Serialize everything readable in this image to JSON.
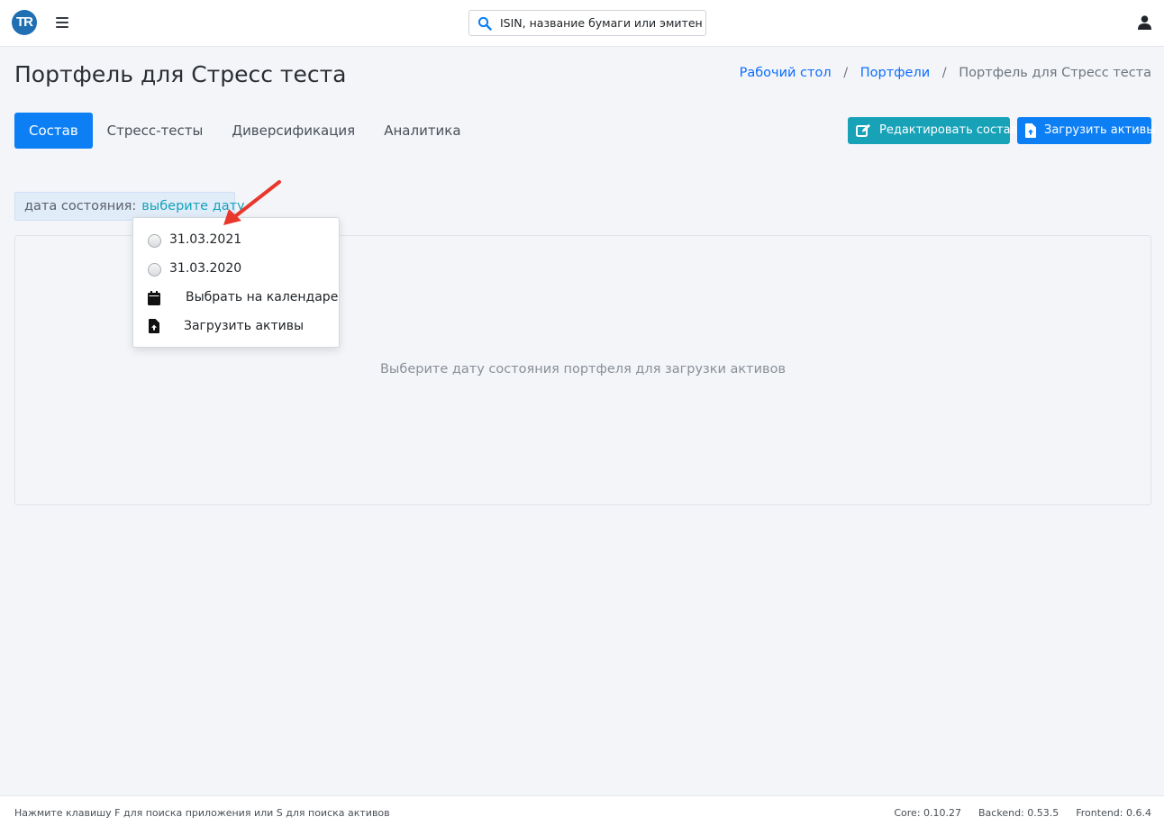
{
  "app": {
    "logo_text": "TR"
  },
  "search": {
    "placeholder": "ISIN, название бумаги или эмитента"
  },
  "header": {
    "title": "Портфель для Стресс теста",
    "breadcrumb": [
      "Рабочий стол",
      "Портфели",
      "Портфель для Стресс теста"
    ]
  },
  "tabs": [
    "Состав",
    "Стресс-тесты",
    "Диверсификация",
    "Аналитика"
  ],
  "active_tab": "Состав",
  "actions": {
    "edit_label": "Редактировать состав",
    "upload_label": "Загрузить активы"
  },
  "date_state": {
    "label": "дата состояния:",
    "link": "выберите дату"
  },
  "dropdown": {
    "dates": [
      "31.03.2021",
      "31.03.2020"
    ],
    "calendar_label": "Выбрать на календаре",
    "upload_label": "Загрузить активы"
  },
  "panel": {
    "empty_text": "Выберите дату состояния портфеля для загрузки активов"
  },
  "footer": {
    "hint": "Нажмите клавишу F для поиска приложения или S для поиска активов",
    "core": "Core: 0.10.27",
    "backend": "Backend: 0.53.5",
    "frontend": "Frontend: 0.6.4"
  },
  "colors": {
    "primary": "#0d7ff5",
    "info": "#17a2b8",
    "arrow": "#e8372c",
    "logo": "#1f6fb2"
  },
  "icons": [
    "menu-icon",
    "search-icon",
    "user-icon",
    "edit-icon",
    "file-upload-icon",
    "calendar-icon"
  ]
}
